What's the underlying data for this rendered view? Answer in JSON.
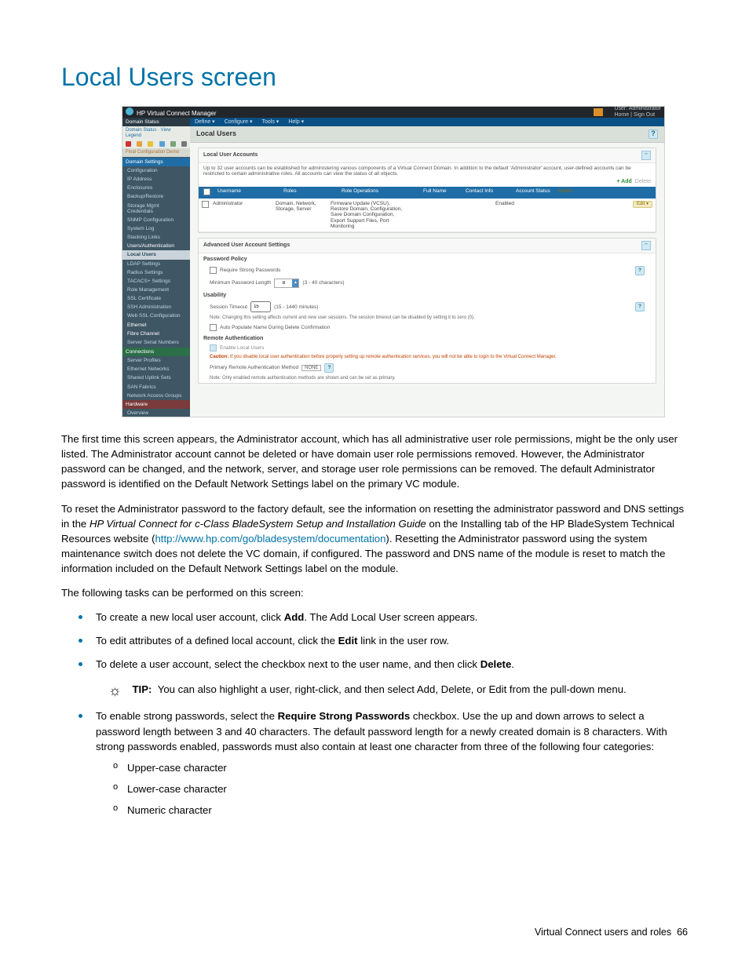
{
  "page": {
    "title": "Local Users screen",
    "footer": "Virtual Connect users and roles",
    "pageNo": "66"
  },
  "shot": {
    "appTitle": "HP Virtual Connect Manager",
    "userLabel": "User: Administrator",
    "signout": "Home | Sign Out",
    "menu": [
      "Define ▾",
      "Configure ▾",
      "Tools ▾",
      "Help ▾"
    ],
    "statusBar": "Domain Status",
    "statusLink": "Domain Status · View Legend",
    "sidebar": {
      "sec1_hdr": "Domain Settings",
      "config_hdr": "Final Configuration Demo",
      "items1": [
        "Configuration",
        "IP Address",
        "Enclosures",
        "Backup/Restore",
        "Storage Mgmt Credentials",
        "SNMP Configuration",
        "System Log",
        "Stacking Links"
      ],
      "sec2_hdr": "Users/Authentication",
      "items2": [
        "Local Users",
        "LDAP Settings",
        "Radius Settings",
        "TACACS+ Settings",
        "Role Management",
        "SSL Certificate",
        "SSH Administration",
        "Web SSL Configuration"
      ],
      "eth": "Ethernet",
      "fc": "Fibre Channel",
      "ssn": "Server Serial Numbers",
      "conn_hdr": "Connections",
      "items3": [
        "Server Profiles",
        "Ethernet Networks",
        "Shared Uplink Sets",
        "SAN Fabrics",
        "Network Access Groups"
      ],
      "hw_hdr": "Hardware",
      "items4": [
        "Overview"
      ]
    },
    "main": {
      "heading": "Local Users",
      "panel1": {
        "title": "Local User Accounts",
        "note": "Up to 32 user accounts can be established for administering various components of a Virtual Connect Domain. In addition to the default 'Administrator' account, user-defined accounts can be restricted to certain administrative roles. All accounts can view the status of all objects.",
        "addBtn": "+ Add",
        "delBtn": "Delete",
        "cols": [
          "",
          "Username",
          "Roles",
          "Role Operations",
          "Full Name",
          "Contact Info",
          "Account Status",
          "Action"
        ],
        "row": {
          "user": "Administrator",
          "roles": "Domain, Network, Storage, Server",
          "ops": "Firmware Update (VCSU), Restore Domain, Configuration, Save Domain Configuration, Export Support Files, Port Monitoring",
          "status": "Enabled",
          "edit": "Edit ▾"
        }
      },
      "panel2": {
        "title": "Advanced User Account Settings",
        "pw_hdr": "Password Policy",
        "pw_chk": "Require Strong Passwords",
        "pw_len_lbl": "Minimum Password Length",
        "pw_len_val": "8",
        "pw_len_note": "(3 - 40 characters)",
        "us_hdr": "Usability",
        "sess_lbl": "Session Timeout",
        "sess_val": "15",
        "sess_note": "(15 - 1440 minutes)",
        "sess_help": "Note: Changing this setting affects current and new user sessions. The session timeout can be disabled by setting it to zero (0).",
        "autopop": "Auto Populate Name During Delete Confirmation",
        "ra_hdr": "Remote Authentication",
        "ra_chk": "Enable Local Users",
        "ra_caution_lbl": "Caution:",
        "ra_caution": "If you disable local user authentication before properly setting up remote authentication services, you will not be able to login to the Virtual Connect Manager.",
        "ra_prim_lbl": "Primary Remote Authentication Method",
        "ra_prim_val": "NONE",
        "ra_note": "Note: Only enabled remote authentication methods are shown and can be set as primary."
      }
    }
  },
  "body": {
    "p1": "The first time this screen appears, the Administrator account, which has all administrative user role permissions, might be the only user listed. The Administrator account cannot be deleted or have domain user role permissions removed. However, the Administrator password can be changed, and the network, server, and storage user role permissions can be removed. The default Administrator password is identified on the Default Network Settings label on the primary VC module.",
    "p2a": "To reset the Administrator password to the factory default, see the information on resetting the administrator password and DNS settings in the ",
    "p2b": "HP Virtual Connect for c-Class BladeSystem Setup and Installation Guide",
    "p2c": " on the Installing tab of the HP BladeSystem Technical Resources website (",
    "p2link": "http://www.hp.com/go/bladesystem/documentation",
    "p2d": "). Resetting the Administrator password using the system maintenance switch does not delete the VC domain, if configured. The password and DNS name of the module is reset to match the information included on the Default Network Settings label on the module.",
    "p3": "The following tasks can be performed on this screen:",
    "li1a": "To create a new local user account, click ",
    "li1b": "Add",
    "li1c": ". The Add Local User screen appears.",
    "li2a": "To edit attributes of a defined local account, click the ",
    "li2b": "Edit",
    "li2c": " link in the user row.",
    "li3a": "To delete a user account, select the checkbox next to the user name, and then click ",
    "li3b": "Delete",
    "li3c": ".",
    "tip_lbl": "TIP:",
    "tip": "You can also highlight a user, right-click, and then select Add, Delete, or Edit from the pull-down menu.",
    "li4a": "To enable strong passwords, select the ",
    "li4b": "Require Strong Passwords",
    "li4c": " checkbox. Use the up and down arrows to select a password length between 3 and 40 characters. The default password length for a newly created domain is 8 characters. With strong passwords enabled, passwords must also contain at least one character from three of the following four categories:",
    "sub": [
      "Upper-case character",
      "Lower-case character",
      "Numeric character"
    ]
  }
}
